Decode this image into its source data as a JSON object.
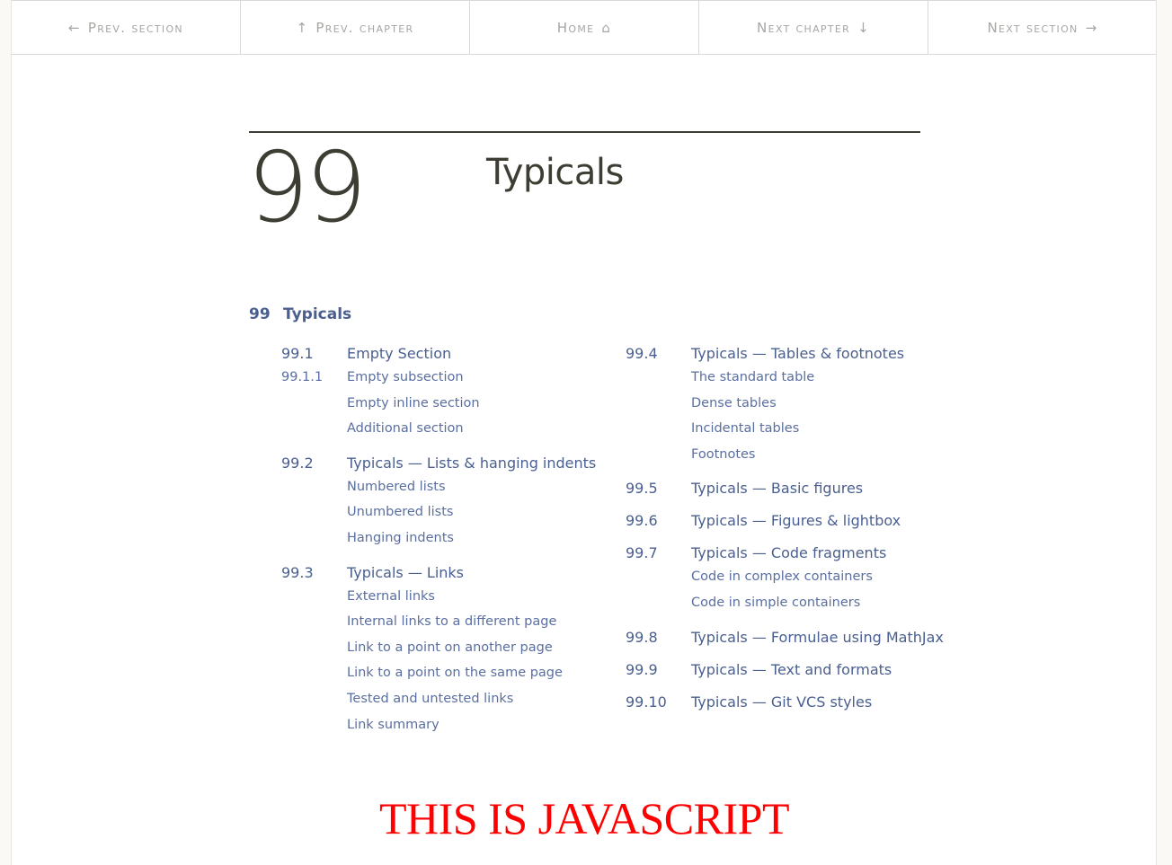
{
  "nav": {
    "prev_section": "Prev. section",
    "prev_chapter": "Prev. chapter",
    "home": "Home",
    "next_chapter": "Next chapter",
    "next_section": "Next section",
    "icons": {
      "prev_section": "arrow-left-icon",
      "prev_chapter": "arrow-up-icon",
      "home": "home-icon",
      "next_chapter": "arrow-down-icon",
      "next_section": "arrow-right-icon"
    }
  },
  "chapter": {
    "number": "99",
    "title": "Typicals"
  },
  "toc": {
    "head": {
      "num": "99",
      "title": "Typicals"
    },
    "left": [
      {
        "num": "99.1",
        "title": "Empty Section",
        "sub_numbered": {
          "num": "99.1.1",
          "title": "Empty subsection"
        },
        "subs": [
          "Empty inline section",
          "Additional section"
        ]
      },
      {
        "num": "99.2",
        "title": "Typicals — Lists & hanging indents",
        "subs": [
          "Numbered lists",
          "Unumbered lists",
          "Hanging indents"
        ]
      },
      {
        "num": "99.3",
        "title": "Typicals — Links",
        "subs": [
          "External links",
          "Internal links to a different page",
          "Link to a point on another page",
          "Link to a point on the same page",
          "Tested and untested links",
          "Link summary"
        ]
      }
    ],
    "right": [
      {
        "num": "99.4",
        "title": "Typicals — Tables & footnotes",
        "subs": [
          "The standard table",
          "Dense tables",
          "Incidental tables",
          "Footnotes"
        ]
      },
      {
        "num": "99.5",
        "title": "Typicals — Basic figures",
        "subs": []
      },
      {
        "num": "99.6",
        "title": "Typicals — Figures & lightbox",
        "subs": []
      },
      {
        "num": "99.7",
        "title": "Typicals — Code fragments",
        "subs": [
          "Code in complex containers",
          "Code in simple containers"
        ]
      },
      {
        "num": "99.8",
        "title": "Typicals — Formulae using MathJax",
        "subs": []
      },
      {
        "num": "99.9",
        "title": "Typicals — Text and formats",
        "subs": []
      },
      {
        "num": "99.10",
        "title": "Typicals — Git VCS styles",
        "subs": []
      }
    ]
  },
  "banner": {
    "text": "THIS IS JAVASCRIPT",
    "color": "#ff0000"
  },
  "colors": {
    "link": "#4a5f90",
    "nav_text": "#a6a6a2",
    "heading": "#3d3d33"
  }
}
